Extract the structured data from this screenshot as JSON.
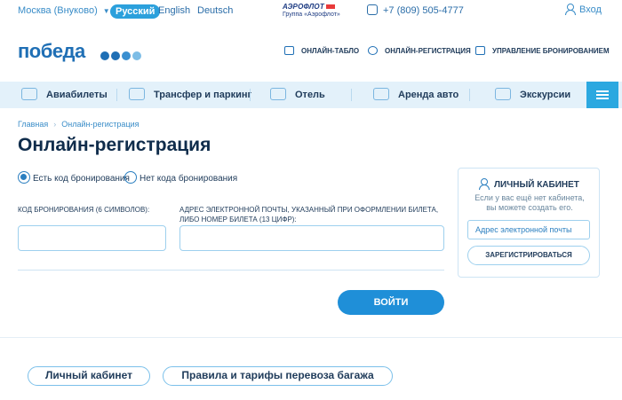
{
  "topbar": {
    "city": "Москва (Внуково)",
    "languages": [
      "Русский",
      "English",
      "Deutsch"
    ],
    "partner_logo_line1": "АЭРОФЛОТ",
    "partner_logo_line2": "Группа «Аэрофлот»",
    "phone": "+7 (809) 505-4777",
    "login": "Вход"
  },
  "header": {
    "logo": "победа",
    "logo_dot_colors": [
      "#1f6fb5",
      "#1f6fb5",
      "#3a8fd0",
      "#7dbde6"
    ],
    "links": [
      "ОНЛАЙН-ТАБЛО",
      "ОНЛАЙН-РЕГИСТРАЦИЯ",
      "УПРАВЛЕНИЕ БРОНИРОВАНИЕМ"
    ]
  },
  "nav": {
    "items": [
      "Авиабилеты",
      "Трансфер и паркинг",
      "Отель",
      "Аренда авто",
      "Экскурсии"
    ],
    "icons": [
      "plane-icon",
      "bus-icon",
      "hotel-icon",
      "car-icon",
      "signpost-icon"
    ]
  },
  "breadcrumb": [
    "Главная",
    "Онлайн-регистрация"
  ],
  "page_title": "Онлайн-регистрация",
  "form": {
    "radio_options": [
      "Есть код бронирования",
      "Нет кода бронирования"
    ],
    "selected_option": "Есть код бронирования",
    "booking_code_label": "КОД БРОНИРОВАНИЯ (6 СИМВОЛОВ):",
    "email_label_line1": "АДРЕС ЭЛЕКТРОННОЙ ПОЧТЫ, УКАЗАННЫЙ ПРИ ОФОРМЛЕНИИ БИЛЕТА,",
    "email_label_line2": "ЛИБО НОМЕР БИЛЕТА (13 ЦИФР):",
    "submit_label": "ВОЙТИ"
  },
  "cabinet": {
    "title": "ЛИЧНЫЙ КАБИНЕТ",
    "description_line1": "Если у вас ещё нет кабинета,",
    "description_line2": "вы можете создать его.",
    "email_placeholder": "Адрес электронной почты",
    "register_label": "ЗАРЕГИСТРИРОВАТЬСЯ"
  },
  "footer": {
    "pills": [
      "Личный кабинет",
      "Правила и тарифы перевоза багажа"
    ]
  },
  "colors": {
    "accent": "#2ba0dc",
    "primary_button": "#1f8fd8",
    "nav_background": "#e3f1fa",
    "text_dark": "#0f2c4b"
  }
}
